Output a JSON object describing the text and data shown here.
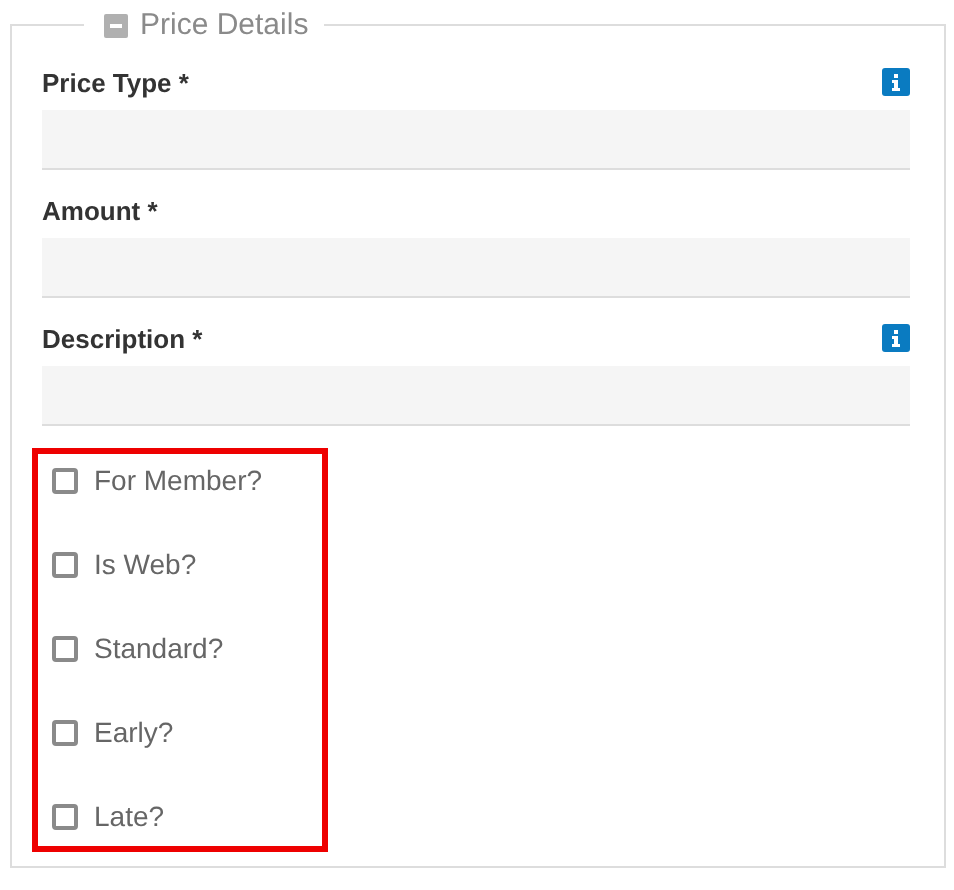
{
  "section": {
    "title": "Price Details"
  },
  "fields": [
    {
      "label": "Price Type *",
      "info": true
    },
    {
      "label": "Amount *",
      "info": false
    },
    {
      "label": "Description *",
      "info": true
    }
  ],
  "checkboxes": [
    {
      "label": "For Member?",
      "checked": false
    },
    {
      "label": "Is Web?",
      "checked": false
    },
    {
      "label": "Standard?",
      "checked": false
    },
    {
      "label": "Early?",
      "checked": false
    },
    {
      "label": "Late?",
      "checked": false
    }
  ]
}
